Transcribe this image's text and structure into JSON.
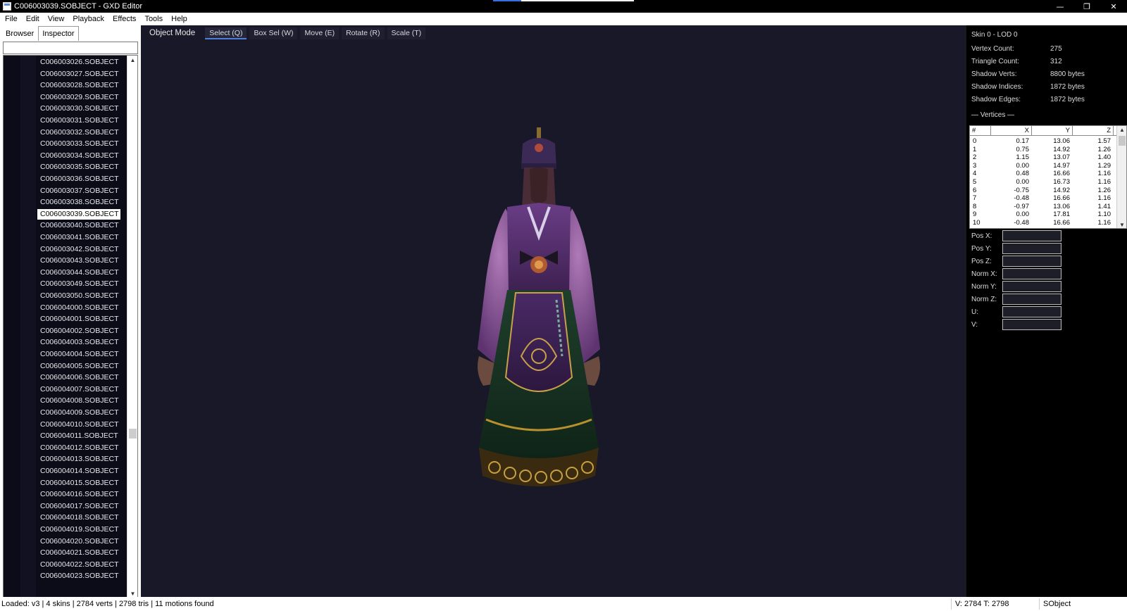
{
  "window": {
    "title": "C006003039.SOBJECT - GXD Editor",
    "minimize_glyph": "—",
    "maximize_glyph": "❐",
    "close_glyph": "✕"
  },
  "menu": [
    "File",
    "Edit",
    "View",
    "Playback",
    "Effects",
    "Tools",
    "Help"
  ],
  "left_panel": {
    "tabs": [
      "Browser",
      "Inspector"
    ],
    "active_tab": "Inspector",
    "search_value": "",
    "selected_item": "C006003039.SOBJECT",
    "items": [
      "C006003026.SOBJECT",
      "C006003027.SOBJECT",
      "C006003028.SOBJECT",
      "C006003029.SOBJECT",
      "C006003030.SOBJECT",
      "C006003031.SOBJECT",
      "C006003032.SOBJECT",
      "C006003033.SOBJECT",
      "C006003034.SOBJECT",
      "C006003035.SOBJECT",
      "C006003036.SOBJECT",
      "C006003037.SOBJECT",
      "C006003038.SOBJECT",
      "C006003039.SOBJECT",
      "C006003040.SOBJECT",
      "C006003041.SOBJECT",
      "C006003042.SOBJECT",
      "C006003043.SOBJECT",
      "C006003044.SOBJECT",
      "C006003049.SOBJECT",
      "C006003050.SOBJECT",
      "C006004000.SOBJECT",
      "C006004001.SOBJECT",
      "C006004002.SOBJECT",
      "C006004003.SOBJECT",
      "C006004004.SOBJECT",
      "C006004005.SOBJECT",
      "C006004006.SOBJECT",
      "C006004007.SOBJECT",
      "C006004008.SOBJECT",
      "C006004009.SOBJECT",
      "C006004010.SOBJECT",
      "C006004011.SOBJECT",
      "C006004012.SOBJECT",
      "C006004013.SOBJECT",
      "C006004014.SOBJECT",
      "C006004015.SOBJECT",
      "C006004016.SOBJECT",
      "C006004017.SOBJECT",
      "C006004018.SOBJECT",
      "C006004019.SOBJECT",
      "C006004020.SOBJECT",
      "C006004021.SOBJECT",
      "C006004022.SOBJECT",
      "C006004023.SOBJECT"
    ]
  },
  "toolbar": {
    "mode_label": "Object Mode",
    "buttons": [
      "Select (Q)",
      "Box Sel (W)",
      "Move (E)",
      "Rotate (R)",
      "Scale (T)"
    ],
    "active_button": "Select (Q)"
  },
  "right_panel": {
    "title": "Skin 0 - LOD 0",
    "stats": [
      {
        "label": "Vertex Count:",
        "value": "275"
      },
      {
        "label": "Triangle Count:",
        "value": "312"
      },
      {
        "label": "Shadow Verts:",
        "value": "8800 bytes"
      },
      {
        "label": "Shadow Indices:",
        "value": "1872 bytes"
      },
      {
        "label": "Shadow Edges:",
        "value": "1872 bytes"
      }
    ],
    "vertices_header": "— Vertices —",
    "columns": [
      "#",
      "X",
      "Y",
      "Z"
    ],
    "rows": [
      [
        "0",
        "0.17",
        "13.06",
        "1.57"
      ],
      [
        "1",
        "0.75",
        "14.92",
        "1.26"
      ],
      [
        "2",
        "1.15",
        "13.07",
        "1.40"
      ],
      [
        "3",
        "0.00",
        "14.97",
        "1.29"
      ],
      [
        "4",
        "0.48",
        "16.66",
        "1.16"
      ],
      [
        "5",
        "0.00",
        "16.73",
        "1.16"
      ],
      [
        "6",
        "-0.75",
        "14.92",
        "1.26"
      ],
      [
        "7",
        "-0.48",
        "16.66",
        "1.16"
      ],
      [
        "8",
        "-0.97",
        "13.06",
        "1.41"
      ],
      [
        "9",
        "0.00",
        "17.81",
        "1.10"
      ],
      [
        "10",
        "-0.48",
        "16.66",
        "1.16"
      ]
    ],
    "fields": [
      {
        "label": "Pos X:",
        "value": ""
      },
      {
        "label": "Pos Y:",
        "value": ""
      },
      {
        "label": "Pos Z:",
        "value": ""
      },
      {
        "label": "Norm X:",
        "value": ""
      },
      {
        "label": "Norm Y:",
        "value": ""
      },
      {
        "label": "Norm Z:",
        "value": ""
      },
      {
        "label": "U:",
        "value": ""
      },
      {
        "label": "V:",
        "value": ""
      }
    ]
  },
  "status": {
    "left": "Loaded: v3 | 4 skins | 2784 verts | 2798 tris | 11 motions found",
    "mid": "V: 2784   T: 2798",
    "right": "SObject"
  },
  "colors": {
    "viewport_bg": "#181828",
    "list_bg": "#0c0c18",
    "accent": "#4e7fd8"
  }
}
